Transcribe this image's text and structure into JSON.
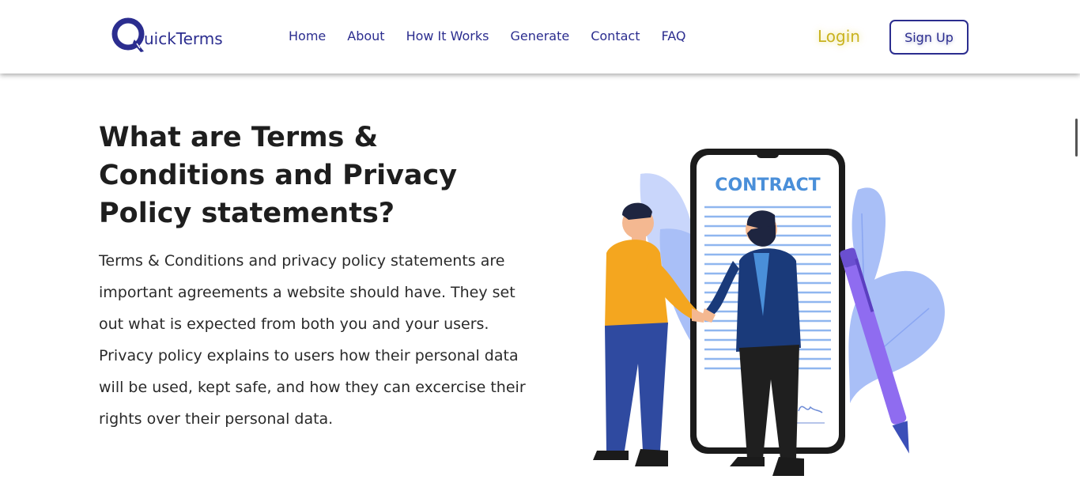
{
  "brand": {
    "name": "uickTerms",
    "logo_letter": "Q"
  },
  "nav": {
    "items": [
      {
        "label": "Home"
      },
      {
        "label": "About"
      },
      {
        "label": "How It Works"
      },
      {
        "label": "Generate"
      },
      {
        "label": "Contact"
      },
      {
        "label": "FAQ"
      }
    ],
    "login_label": "Login",
    "signup_label": "Sign Up"
  },
  "hero": {
    "title": "What are Terms & Conditions and Privacy Policy statements?",
    "body": "Terms & Conditions and privacy policy statements are important agreements a website should have. They set out what is expected from both you and your users. Privacy policy explains to users how their personal data will be used, kept safe, and how they can excercise their rights over their personal data.",
    "illustration_label": "CONTRACT"
  },
  "colors": {
    "brand": "#2b2d8f",
    "login": "#c9b320",
    "leaf": "#a9bff7",
    "pen": "#8f6cf0"
  },
  "icons": {
    "logo": "quickterms-logo-icon",
    "handshake": "handshake-illustration",
    "pen": "pen-icon"
  }
}
